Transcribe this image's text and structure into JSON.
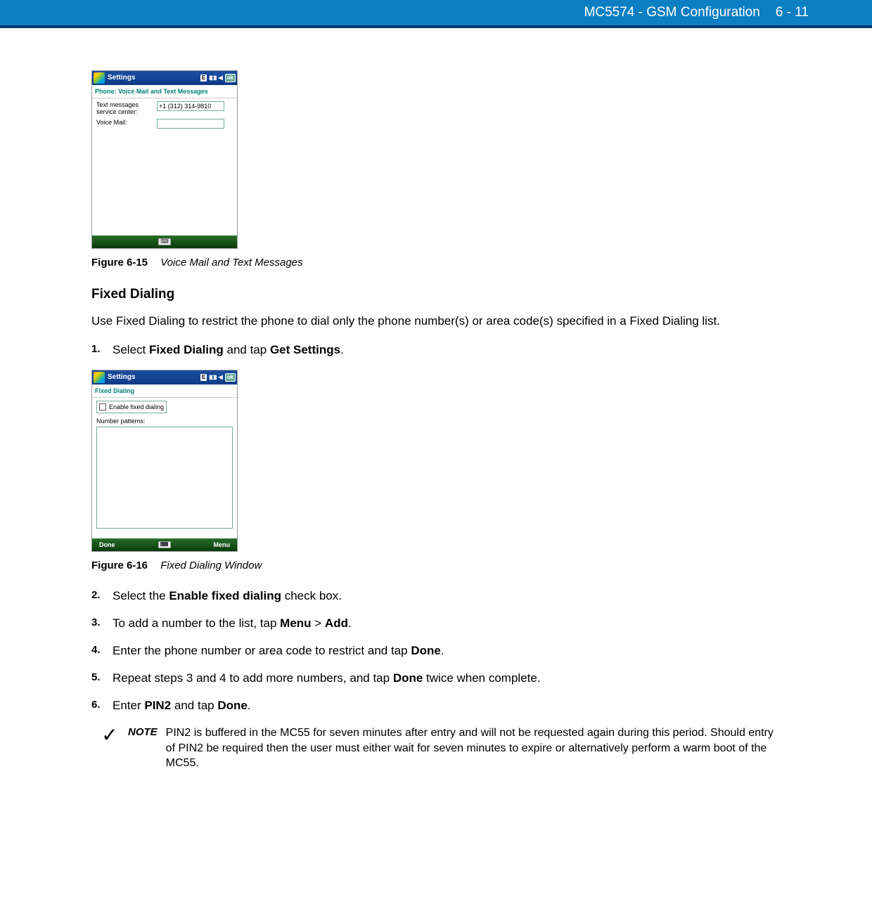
{
  "header": {
    "title": "MC5574 - GSM Configuration",
    "page": "6 - 11"
  },
  "figure15": {
    "settings_title": "Settings",
    "subtitle": "Phone: Voice Mail and Text Messages",
    "row1_label": "Text messages service center:",
    "row1_value": "+1 (312) 314-9810",
    "row2_label": "Voice Mail:",
    "row2_value": "",
    "ok": "ok",
    "e": "E",
    "caption_num": "Figure 6-15",
    "caption_text": "Voice Mail and Text Messages"
  },
  "section": {
    "heading": "Fixed Dialing",
    "intro": "Use Fixed Dialing to restrict the phone to dial only the phone number(s) or area code(s) specified in a Fixed Dialing list."
  },
  "steps": {
    "s1_pre": "Select ",
    "s1_b1": "Fixed Dialing",
    "s1_mid": " and tap ",
    "s1_b2": "Get Settings",
    "s1_end": ".",
    "s2_pre": "Select the ",
    "s2_b1": "Enable fixed dialing",
    "s2_end": " check box.",
    "s3_pre": "To add a number to the list, tap ",
    "s3_b1": "Menu",
    "s3_gt": " > ",
    "s3_b2": "Add",
    "s3_end": ".",
    "s4_pre": "Enter the phone number or area code to restrict and tap ",
    "s4_b1": "Done",
    "s4_end": ".",
    "s5_pre": "Repeat steps 3 and 4 to add more numbers, and tap ",
    "s5_b1": "Done",
    "s5_end": " twice when complete.",
    "s6_pre": "Enter ",
    "s6_b1": "PIN2",
    "s6_mid": " and tap ",
    "s6_b2": "Done",
    "s6_end": "."
  },
  "step_nums": {
    "n1": "1.",
    "n2": "2.",
    "n3": "3.",
    "n4": "4.",
    "n5": "5.",
    "n6": "6."
  },
  "figure16": {
    "settings_title": "Settings",
    "subtitle": "Fixed Dialing",
    "checkbox_label": "Enable fixed dialing",
    "list_label": "Number patterns:",
    "done": "Done",
    "menu": "Menu",
    "ok": "ok",
    "e": "E",
    "caption_num": "Figure 6-16",
    "caption_text": "Fixed Dialing Window"
  },
  "note": {
    "label": "NOTE",
    "text": "PIN2 is buffered in the MC55 for seven minutes after entry and will not be requested again during this period. Should entry of PIN2 be required then the user must either wait for seven minutes to expire or alternatively perform a warm boot of the MC55."
  }
}
